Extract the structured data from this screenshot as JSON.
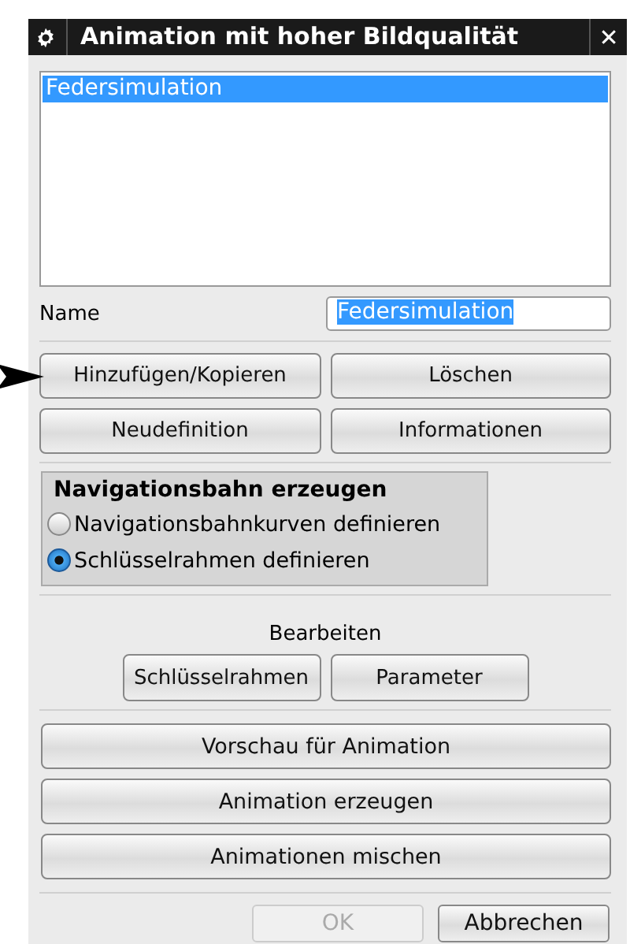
{
  "window": {
    "title": "Animation mit hoher Bildqualität",
    "close": "✕"
  },
  "list": {
    "items": [
      {
        "label": "Federsimulation",
        "selected": true
      }
    ]
  },
  "name_field": {
    "label": "Name",
    "value": "Federsimulation"
  },
  "action_buttons": [
    {
      "label": "Hinzufügen/Kopieren",
      "pointed": true
    },
    {
      "label": "Löschen",
      "pointed": false
    },
    {
      "label": "Neudefinition",
      "pointed": false
    },
    {
      "label": "Informationen",
      "pointed": false
    }
  ],
  "path_group": {
    "title": "Navigationsbahn erzeugen",
    "options": [
      {
        "label": "Navigationsbahnkurven definieren",
        "selected": false
      },
      {
        "label": "Schlüsselrahmen definieren",
        "selected": true
      }
    ]
  },
  "edit": {
    "label": "Bearbeiten",
    "buttons": [
      "Schlüsselrahmen",
      "Parameter"
    ]
  },
  "wide_buttons": [
    "Vorschau für Animation",
    "Animation erzeugen",
    "Animationen mischen"
  ],
  "footer_buttons": [
    {
      "label": "OK",
      "disabled": true
    },
    {
      "label": "Abbrechen",
      "disabled": false
    }
  ]
}
